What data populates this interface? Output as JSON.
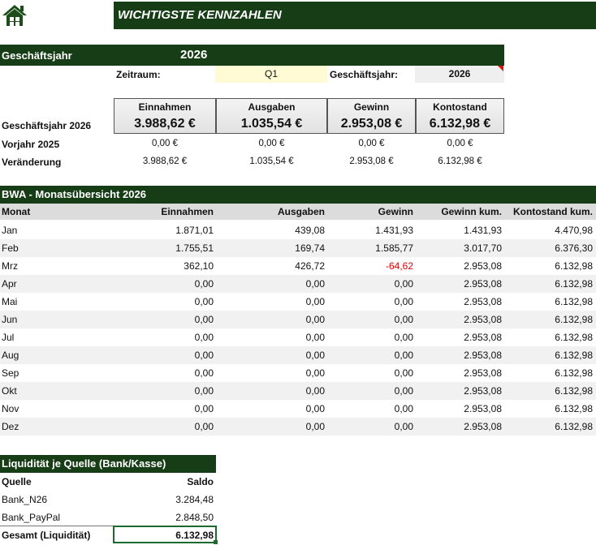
{
  "header": {
    "home_icon": "house-icon",
    "title": "WICHTIGSTE KENNZAHLEN"
  },
  "year": {
    "label": "Geschäftsjahr",
    "value": "2026"
  },
  "filters": {
    "zeitraum_label": "Zeitraum:",
    "zeitraum_value": "Q1",
    "gj_label": "Geschäftsjahr:",
    "gj_value": "2026"
  },
  "kpi": {
    "headers": [
      "Einnahmen",
      "Ausgaben",
      "Gewinn",
      "Kontostand"
    ],
    "row_label": "Geschäftsjahr 2026",
    "values": [
      "3.988,62 €",
      "1.035,54 €",
      "2.953,08 €",
      "6.132,98 €"
    ]
  },
  "comparison": {
    "prev_label": "Vorjahr 2025",
    "prev_values": [
      "0,00 €",
      "0,00 €",
      "0,00 €",
      "0,00 €"
    ],
    "change_label": "Veränderung",
    "change_values": [
      "3.988,62 €",
      "1.035,54 €",
      "2.953,08 €",
      "6.132,98 €"
    ]
  },
  "bwa": {
    "title": "BWA - Monatsübersicht 2026",
    "columns": [
      "Monat",
      "Einnahmen",
      "Ausgaben",
      "Gewinn",
      "Gewinn kum.",
      "Kontostand kum."
    ],
    "rows": [
      [
        "Jan",
        "1.871,01",
        "439,08",
        "1.431,93",
        "1.431,93",
        "4.470,98"
      ],
      [
        "Feb",
        "1.755,51",
        "169,74",
        "1.585,77",
        "3.017,70",
        "6.376,30"
      ],
      [
        "Mrz",
        "362,10",
        "426,72",
        "-64,62",
        "2.953,08",
        "6.132,98"
      ],
      [
        "Apr",
        "0,00",
        "0,00",
        "0,00",
        "2.953,08",
        "6.132,98"
      ],
      [
        "Mai",
        "0,00",
        "0,00",
        "0,00",
        "2.953,08",
        "6.132,98"
      ],
      [
        "Jun",
        "0,00",
        "0,00",
        "0,00",
        "2.953,08",
        "6.132,98"
      ],
      [
        "Jul",
        "0,00",
        "0,00",
        "0,00",
        "2.953,08",
        "6.132,98"
      ],
      [
        "Aug",
        "0,00",
        "0,00",
        "0,00",
        "2.953,08",
        "6.132,98"
      ],
      [
        "Sep",
        "0,00",
        "0,00",
        "0,00",
        "2.953,08",
        "6.132,98"
      ],
      [
        "Okt",
        "0,00",
        "0,00",
        "0,00",
        "2.953,08",
        "6.132,98"
      ],
      [
        "Nov",
        "0,00",
        "0,00",
        "0,00",
        "2.953,08",
        "6.132,98"
      ],
      [
        "Dez",
        "0,00",
        "0,00",
        "0,00",
        "2.953,08",
        "6.132,98"
      ]
    ]
  },
  "liquidity": {
    "title": "Liquidität je Quelle (Bank/Kasse)",
    "columns": [
      "Quelle",
      "Saldo"
    ],
    "rows": [
      [
        "Bank_N26",
        "3.284,48"
      ],
      [
        "Bank_PayPal",
        "2.848,50"
      ]
    ],
    "total_label": "Gesamt (Liquidität)",
    "total_value": "6.132,98"
  },
  "colors": {
    "header_green": "#173d16",
    "negative": "#e00000",
    "input_yellow": "#fffbd5"
  }
}
